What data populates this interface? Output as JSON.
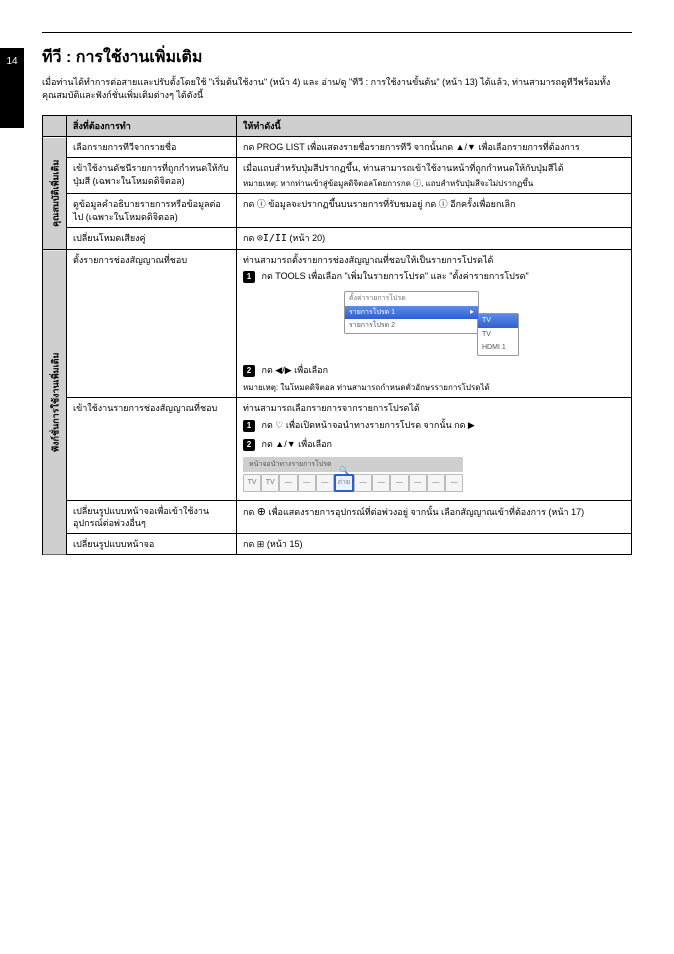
{
  "page_number": "14",
  "header_title": "ทีวี : การใช้งานเพิ่มเติม",
  "header_subtitle": "เมื่อท่านได้ทำการต่อสายและปรับตั้งโดยใช้ \"เริ่มต้นใช้งาน\" (หน้า 4) และ อ่าน/ดู \"ทีวี : การใช้งานขั้นต้น\" (หน้า 13) ได้แล้ว, ท่านสามารถดูทีวีพร้อมทั้งคุณสมบัติและฟังก์ชั่นเพิ่มเติมต่างๆ ได้ดังนี้",
  "table_headers": {
    "todo": "สิ่งที่ต้องการทำ",
    "do_this": "ให้ทำดังนี้"
  },
  "category_labels": {
    "features": "คุณสมบัติเพิ่มเติม",
    "functions": "ฟังก์ชั่นการใช้งานเพิ่มเติม"
  },
  "rows": [
    {
      "todo": "เลือกรายการทีวีจากรายชื่อ",
      "do": "กด PROG LIST เพื่อแสดงรายชื่อรายการทีวี จากนั้นกด ▲/▼ เพื่อเลือกรายการที่ต้องการ"
    },
    {
      "todo": "เข้าใช้งานดัชนีรายการที่ถูกกำหนดให้กับปุ่มสี (เฉพาะในโหมดดิจิตอล)",
      "do": "เมื่อแถบสำหรับปุ่มสีปรากฏขึ้น, ท่านสามารถเข้าใช้งานหน้าที่ถูกกำหนดให้กับปุ่มสีได้",
      "note": "หมายเหตุ: หากท่านเข้าสู่ข้อมูลดิจิตอลโดยการกด ⓘ, แถบสำหรับปุ่มสีจะไม่ปรากฏขึ้น"
    },
    {
      "todo": "ดูข้อมูลคำอธิบายรายการหรือข้อมูลต่อไป (เฉพาะในโหมดดิจิตอล)",
      "do": "กด ⓘ ข้อมูลจะปรากฏขึ้นบนรายการที่รับชมอยู่ กด ⓘ อีกครั้งเพื่อยกเลิก"
    },
    {
      "todo": "เปลี่ยนโหมดเสียงคู่",
      "do_prefix": "กด",
      "do_suffix": " (หน้า 20)"
    },
    {
      "todo": "ตั้งรายการช่องสัญญาณที่ชอบ",
      "do_intro": "ท่านสามารถตั้งรายการช่องสัญญาณที่ชอบให้เป็นรายการโปรดได้",
      "step1": "กด TOOLS เพื่อเลือก \"เพิ่มในรายการโปรด\" และ \"ตั้งค่ารายการโปรด\"",
      "menu": {
        "title": "ตั้งค่ารายการโปรด",
        "items": [
          "รายการโปรด 1",
          "รายการโปรด 2"
        ],
        "submenu": [
          "TV",
          "TV",
          "HDMI 1"
        ]
      },
      "step2": "กด ◀/▶ เพื่อเลือก",
      "note2": "หมายเหตุ: ในโหมดดิจิตอล ท่านสามารถกำหนดตัวอักษรรายการโปรดได้"
    },
    {
      "todo": "เข้าใช้งานรายการช่องสัญญาณที่ชอบ",
      "do_intro2": "ท่านสามารถเลือกรายการจากรายการโปรดได้",
      "step1b": "กด ♡ เพื่อเปิดหน้าจอนำทางรายการโปรด จากนั้น กด ▶",
      "step2b": "กด ▲/▼ เพื่อเลือก",
      "nav_title": "หน้าจอนำทางรายการโปรด",
      "nav_items": [
        "TV",
        "TV",
        "—",
        "—",
        "—",
        "ถ่าย",
        "—",
        "—",
        "—",
        "—",
        "—",
        "—"
      ]
    },
    {
      "todo": "เปลี่ยนรูปแบบหน้าจอเพื่อเข้าใช้งานอุปกรณ์ต่อพ่วงอื่นๆ",
      "do_prefix2": "กด ",
      "do_suffix2": " เพื่อแสดงรายการอุปกรณ์ที่ต่อพ่วงอยู่ จากนั้น เลือกสัญญาณเข้าที่ต้องการ (หน้า 17)"
    },
    {
      "todo": "เปลี่ยนรูปแบบหน้าจอ",
      "do8": "กด ⊞ (หน้า 15)"
    }
  ]
}
